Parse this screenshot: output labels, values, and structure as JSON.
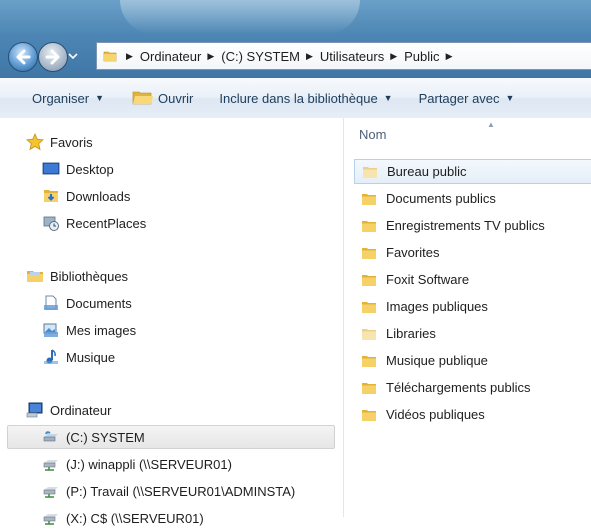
{
  "address": {
    "crumbs": [
      {
        "label": "Ordinateur"
      },
      {
        "label": "(C:) SYSTEM"
      },
      {
        "label": "Utilisateurs"
      },
      {
        "label": "Public"
      }
    ]
  },
  "toolbar": {
    "organize_label": "Organiser",
    "open_label": "Ouvrir",
    "include_label": "Inclure dans la bibliothèque",
    "share_label": "Partager avec"
  },
  "nav": {
    "favorites": {
      "label": "Favoris",
      "items": [
        {
          "label": "Desktop",
          "icon": "desktop-icon"
        },
        {
          "label": "Downloads",
          "icon": "downloads-folder-icon"
        },
        {
          "label": "RecentPlaces",
          "icon": "recent-places-icon"
        }
      ]
    },
    "libraries": {
      "label": "Bibliothèques",
      "items": [
        {
          "label": "Documents",
          "icon": "documents-library-icon"
        },
        {
          "label": "Mes images",
          "icon": "pictures-library-icon"
        },
        {
          "label": "Musique",
          "icon": "music-library-icon"
        }
      ]
    },
    "computer": {
      "label": "Ordinateur",
      "items": [
        {
          "label": "(C:) SYSTEM",
          "icon": "local-drive-icon",
          "selected": true
        },
        {
          "label": "(J:) winappli (\\\\SERVEUR01)",
          "icon": "network-drive-icon"
        },
        {
          "label": "(P:) Travail (\\\\SERVEUR01\\ADMINSTA)",
          "icon": "network-drive-icon"
        },
        {
          "label": "(X:) C$ (\\\\SERVEUR01)",
          "icon": "network-drive-icon"
        }
      ]
    }
  },
  "content": {
    "column_header": "Nom",
    "files": [
      {
        "name": "Bureau public",
        "selected": true
      },
      {
        "name": "Documents publics"
      },
      {
        "name": "Enregistrements TV publics"
      },
      {
        "name": "Favorites"
      },
      {
        "name": "Foxit Software"
      },
      {
        "name": "Images publiques"
      },
      {
        "name": "Libraries"
      },
      {
        "name": "Musique publique"
      },
      {
        "name": "Téléchargements publics"
      },
      {
        "name": "Vidéos publiques"
      }
    ]
  },
  "colors": {
    "title_bar": "#4d86b4",
    "toolbar_text": "#1e3d5c",
    "selection_border": "#b8d1ea",
    "folder_yellow": "#f0c34a"
  }
}
